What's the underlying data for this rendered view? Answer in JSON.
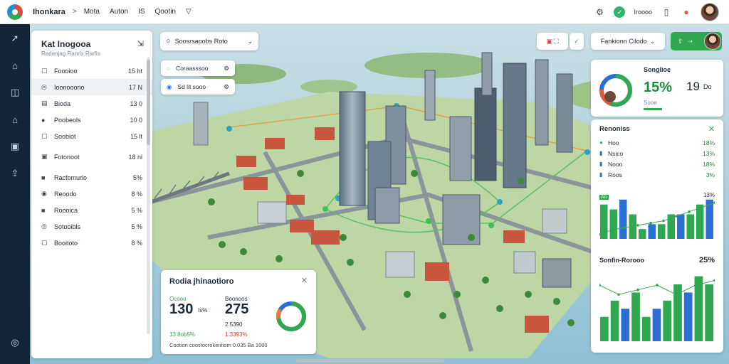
{
  "topbar": {
    "brand": "Ihonkara",
    "crumb_sep": ">",
    "nav": [
      "Mota",
      "Auton",
      "IS",
      "Qootin"
    ],
    "status_label": "Iroooo"
  },
  "search": {
    "text": "Soosrsaoobs Roto"
  },
  "chips": {
    "top": "Coraasssoo",
    "second": "Sd lit sooo"
  },
  "toolbar": {
    "filter_label": "Fankionn Cilodo"
  },
  "left_panel": {
    "title": "Kat Inogooa",
    "subtitle": "Radanjag Ranrlx Rarfis",
    "rows": [
      {
        "icon": "▢",
        "label": "Foooioo",
        "value": "15 ht"
      },
      {
        "icon": "◎",
        "label": "Ioonooono",
        "value": "17 N"
      },
      {
        "icon": "▤",
        "label": "Bioda",
        "value": "13 0"
      },
      {
        "icon": "●",
        "label": "Poobeols",
        "value": "10 0"
      },
      {
        "icon": "▢",
        "label": "Soobiot",
        "value": "15 lt"
      },
      {
        "icon": "▣",
        "label": "Fotonoot",
        "value": "18 nl"
      },
      {
        "icon": "■",
        "label": "Racfomurlo",
        "value": "5%"
      },
      {
        "icon": "◉",
        "label": "Reoodo",
        "value": "8 %"
      },
      {
        "icon": "■",
        "label": "Roooica",
        "value": "5 %"
      },
      {
        "icon": "◎",
        "label": "Sotooibls",
        "value": "5 %"
      },
      {
        "icon": "▢",
        "label": "Booitoto",
        "value": "8 %"
      }
    ]
  },
  "info_card": {
    "title": "Rodia jhinaotioro",
    "left_label": "Ocooo",
    "left_value": "130",
    "left_unit": "Is%",
    "left_sub": "13 8ob5%",
    "mid_label": "Boonoos",
    "mid_value": "275",
    "mid_sub": "2 5390",
    "mid_pct": "1.3393%",
    "footer": "Cootion coostocrokentiom 0.035 Ba 1000",
    "ring_pct": 0.72
  },
  "stats_panel": {
    "title": "Songlioe",
    "big_value": "15%",
    "side_value": "19",
    "side_unit": "Do",
    "sub": "Sooe"
  },
  "metrics_panel": {
    "title": "Renoniss",
    "rows": [
      {
        "icon": "●",
        "label": "Hoo",
        "value": "18%"
      },
      {
        "icon": "▮",
        "label": "Nsico",
        "value": "13%"
      },
      {
        "icon": "▮",
        "label": "Nooo",
        "value": "18%"
      },
      {
        "icon": "▮",
        "label": "Roos",
        "value": "3%"
      }
    ],
    "chart1_label": "13%",
    "chart1_tag": "Ao",
    "chart2_title": "Sonfin-Rorooo",
    "chart2_pct": "25%"
  },
  "colors": {
    "accent_green": "#2fa84f",
    "accent_blue": "#2b6fd6",
    "sidebar": "#14253a"
  },
  "chart_data": [
    {
      "type": "bar",
      "values": [
        7,
        6,
        8,
        5,
        2,
        3,
        3,
        5,
        5,
        5,
        7,
        8
      ],
      "series_colors": [
        "#2fa84f",
        "#2b6fd6"
      ],
      "line": [
        1,
        2,
        2.5,
        3,
        3.5,
        4,
        5,
        6,
        7,
        8
      ]
    },
    {
      "type": "bar",
      "values": [
        3,
        5,
        4,
        6,
        3,
        4,
        5,
        7,
        6,
        8,
        7
      ],
      "series_colors": [
        "#2fa84f",
        "#2b6fd6"
      ],
      "line": [
        6,
        5,
        5.5,
        6,
        5,
        6,
        6.5
      ]
    }
  ]
}
